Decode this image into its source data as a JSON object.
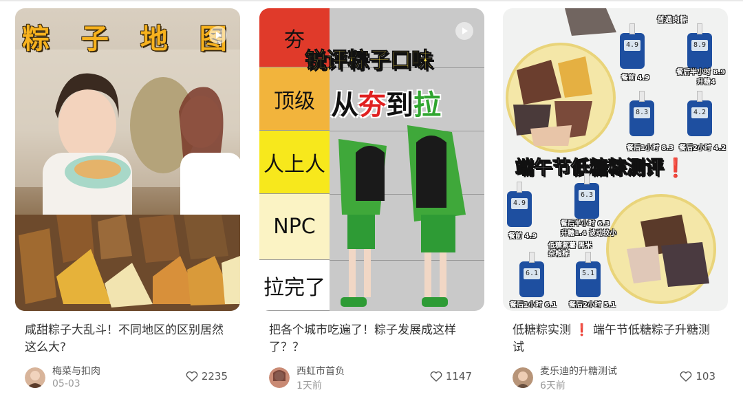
{
  "cards": [
    {
      "cover_text": "粽 子 地 图",
      "title": "咸甜粽子大乱斗！不同地区的区别居然这么大?",
      "author": "梅菜与扣肉",
      "date": "05-03",
      "likes": "2235"
    },
    {
      "tiers": [
        "夯",
        "顶级",
        "人上人",
        "NPC",
        "拉完了"
      ],
      "tier_colors": [
        "#e03a2a",
        "#f2b43c",
        "#f7e81c",
        "#fbf3c4",
        "#ffffff"
      ],
      "headline": "锐评粽子口味",
      "headline2_a": "从",
      "headline2_b": "夯",
      "headline2_c": "到",
      "headline2_d": "拉",
      "title": "把各个城市吃遍了！粽子发展成这样了？？",
      "author": "西虹市首负",
      "date": "1天前",
      "likes": "1147"
    },
    {
      "cover_title": "端午节低糖粽测评",
      "cover_mark": "❗",
      "top_label": "普通肉粽",
      "readings": {
        "r1": "餐前 4.9",
        "r2": "餐后半小时 8.9",
        "r2b": "升糖4",
        "r3": "餐后1小时 8.3",
        "r4": "餐后2小时 4.2",
        "r5": "餐前 4.9",
        "r6": "餐后半小时 6.3",
        "r6b": "升糖1.4 波动较小",
        "r7": "低糖紫薯 黑米杂粮粽",
        "r8": "餐后1小时 6.1",
        "r9": "餐后2小时 5.1"
      },
      "screens": [
        "4.9",
        "8.9",
        "8.3",
        "4.2",
        "4.9",
        "6.3",
        "6.1",
        "5.1"
      ],
      "title_a": "低糖粽实测",
      "title_mark": "❗",
      "title_b": "端午节低糖粽子升糖测试",
      "author": "麦乐迪的升糖测试",
      "date": "6天前",
      "likes": "103"
    }
  ],
  "colors": {
    "accent_red": "#e02020",
    "banner_yellow": "#f7b21e",
    "meter_blue": "#1e4fa0",
    "heading_red": "#e02020",
    "heading_green": "#2fa52f"
  },
  "icons": [
    "play-icon",
    "heart-icon",
    "avatar"
  ]
}
